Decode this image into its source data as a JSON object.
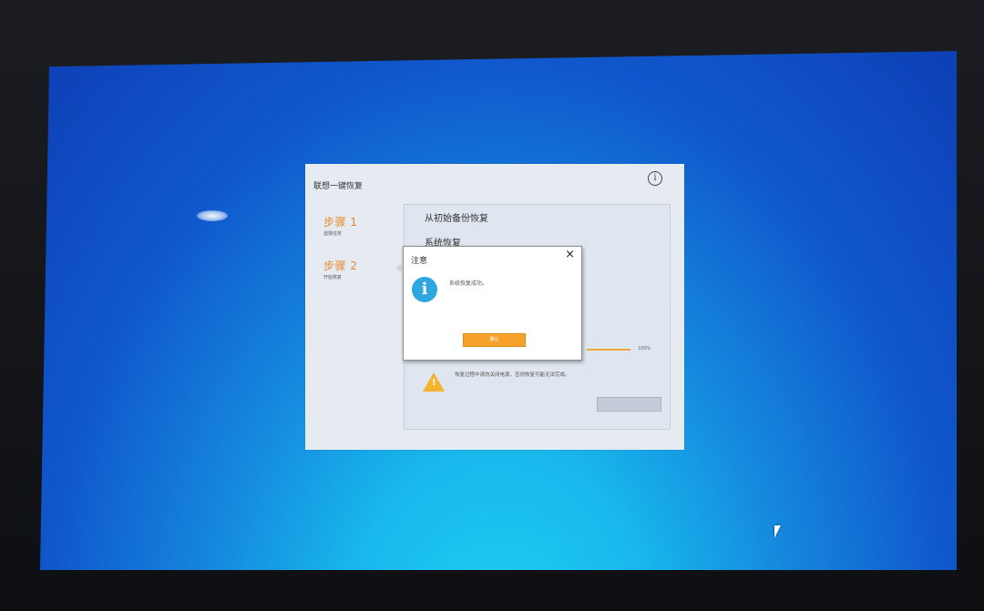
{
  "window": {
    "title": "联想一键恢复",
    "info_icon": "i"
  },
  "steps": [
    {
      "title": "步骤 1",
      "subtitle": "选择任务"
    },
    {
      "title": "步骤 2",
      "subtitle": "开始恢复"
    }
  ],
  "panel": {
    "options": [
      "从初始备份恢复",
      "系统恢复"
    ],
    "progress_percent": "100%",
    "progress_value": 1.0,
    "warning_text": "恢复过程中请勿关闭电源，否则恢复可能无法完成。"
  },
  "dialog": {
    "title": "注意",
    "close_glyph": "×",
    "icon": "i",
    "message": "系统恢复成功。",
    "ok_label": "确认"
  },
  "colors": {
    "accent": "#e78a2a",
    "button": "#f6a12c",
    "info": "#2ea6e0",
    "warning": "#f2b52b"
  }
}
